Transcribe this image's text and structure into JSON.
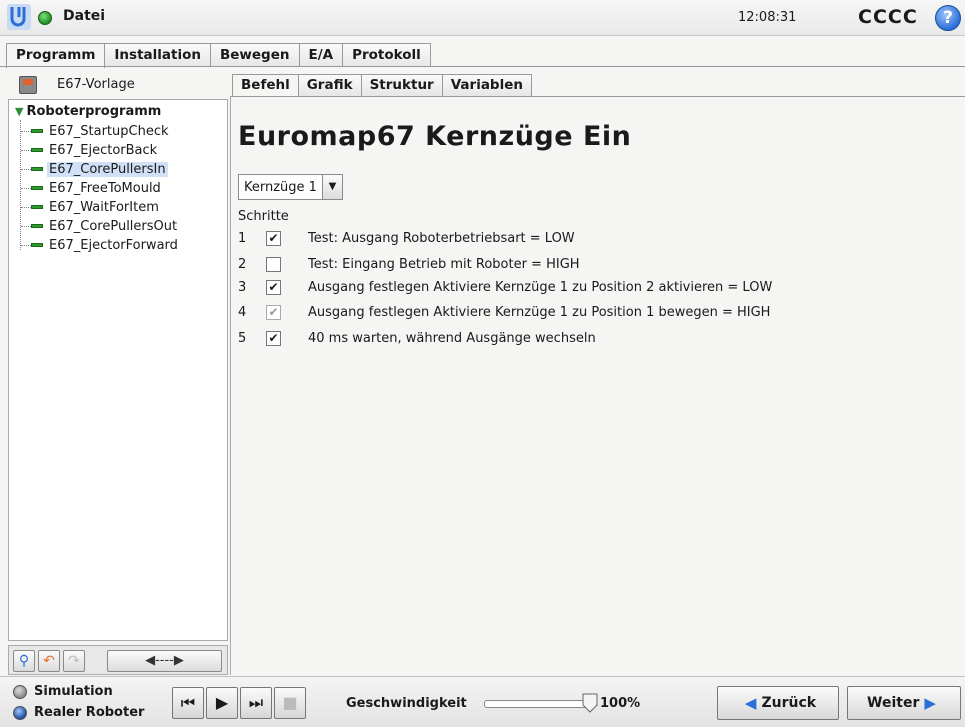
{
  "topbar": {
    "file_menu": "Datei",
    "clock": "12:08:31",
    "robot_name": "CCCC",
    "help": "?"
  },
  "main_tabs": [
    {
      "label": "Programm",
      "active": true
    },
    {
      "label": "Installation",
      "active": false
    },
    {
      "label": "Bewegen",
      "active": false
    },
    {
      "label": "E/A",
      "active": false
    },
    {
      "label": "Protokoll",
      "active": false
    }
  ],
  "program": {
    "name": "E67-Vorlage"
  },
  "tree": {
    "root": "Roboterprogramm",
    "items": [
      {
        "label": "E67_StartupCheck",
        "selected": false
      },
      {
        "label": "E67_EjectorBack",
        "selected": false
      },
      {
        "label": "E67_CorePullersIn",
        "selected": true
      },
      {
        "label": "E67_FreeToMould",
        "selected": false
      },
      {
        "label": "E67_WaitForItem",
        "selected": false
      },
      {
        "label": "E67_CorePullersOut",
        "selected": false
      },
      {
        "label": "E67_EjectorForward",
        "selected": false
      }
    ]
  },
  "tree_toolbar": {
    "search_icon": "magnifier-icon",
    "undo_icon": "undo-arrow-icon",
    "redo_icon": "redo-arrow-icon",
    "wide_label": "◀----▶"
  },
  "sub_tabs": [
    {
      "label": "Befehl",
      "active": true
    },
    {
      "label": "Grafik",
      "active": false
    },
    {
      "label": "Struktur",
      "active": false
    },
    {
      "label": "Variablen",
      "active": false
    }
  ],
  "content": {
    "title": "Euromap67 Kernzüge Ein",
    "dropdown_value": "Kernzüge 1",
    "steps_label": "Schritte",
    "steps": [
      {
        "num": "1",
        "checked": true,
        "enabled": true,
        "text": "Test: Ausgang Roboterbetriebsart = LOW"
      },
      {
        "num": "2",
        "checked": false,
        "enabled": true,
        "text": "Test: Eingang Betrieb mit Roboter = HIGH"
      },
      {
        "num": "3",
        "checked": true,
        "enabled": true,
        "text": "Ausgang festlegen Aktiviere Kernzüge 1 zu Position 2 aktivieren = LOW"
      },
      {
        "num": "4",
        "checked": true,
        "enabled": false,
        "text": "Ausgang festlegen Aktiviere Kernzüge 1 zu Position 1 bewegen = HIGH"
      },
      {
        "num": "5",
        "checked": true,
        "enabled": true,
        "text": "40 ms warten, während Ausgänge wechseln"
      }
    ]
  },
  "bottombar": {
    "mode_simulation": "Simulation",
    "mode_real": "Realer Roboter",
    "speed_label": "Geschwindigkeit",
    "speed_value": "100%",
    "speed_fraction": 1.0,
    "back_label": "Zurück",
    "next_label": "Weiter"
  },
  "colors": {
    "accent": "#2a6fd6",
    "status_green": "#1e8e1e",
    "selection": "#cfe0f7"
  }
}
